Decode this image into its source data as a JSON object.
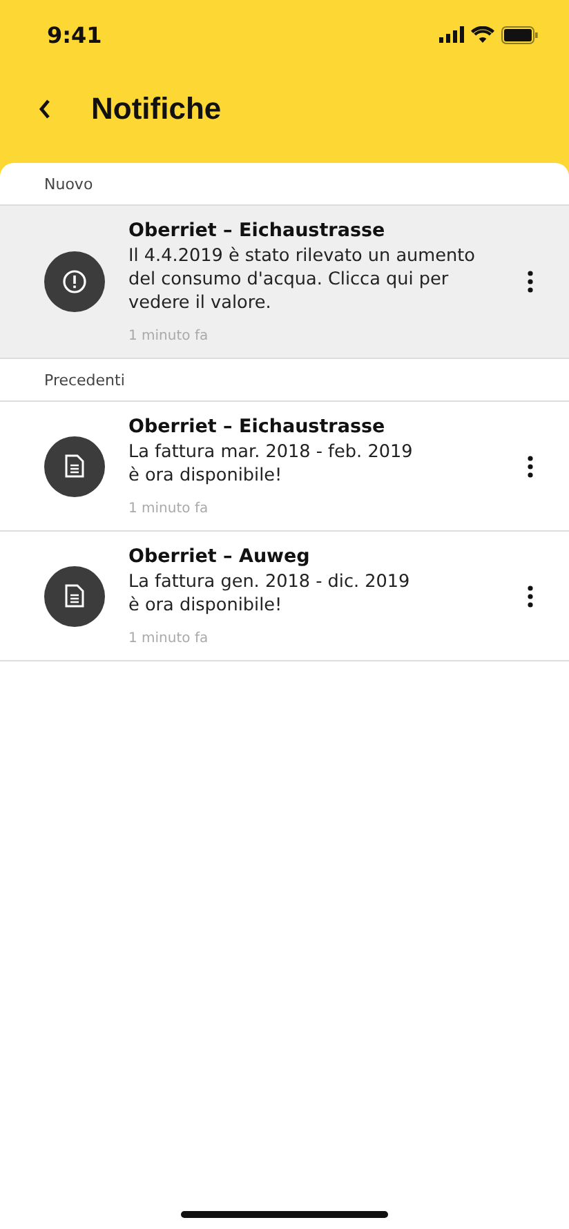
{
  "status_bar": {
    "time": "9:41"
  },
  "header": {
    "title": "Notifiche"
  },
  "sections": [
    {
      "title": "Nuovo",
      "items": [
        {
          "kind": "alert",
          "unread": true,
          "title": "Oberriet – Eichaustrasse",
          "message": "Il 4.4.2019 è stato rilevato un aumento\ndel consumo d'acqua. Clicca qui per\nvedere il valore.",
          "time": "1 minuto fa"
        }
      ]
    },
    {
      "title": "Precedenti",
      "items": [
        {
          "kind": "invoice",
          "unread": false,
          "title": "Oberriet – Eichaustrasse",
          "message": "La fattura mar. 2018 - feb. 2019\nè ora disponibile!",
          "time": "1 minuto fa"
        },
        {
          "kind": "invoice",
          "unread": false,
          "title": "Oberriet – Auweg",
          "message": "La fattura gen. 2018 - dic. 2019\nè ora disponibile!",
          "time": "1 minuto fa"
        }
      ]
    }
  ]
}
